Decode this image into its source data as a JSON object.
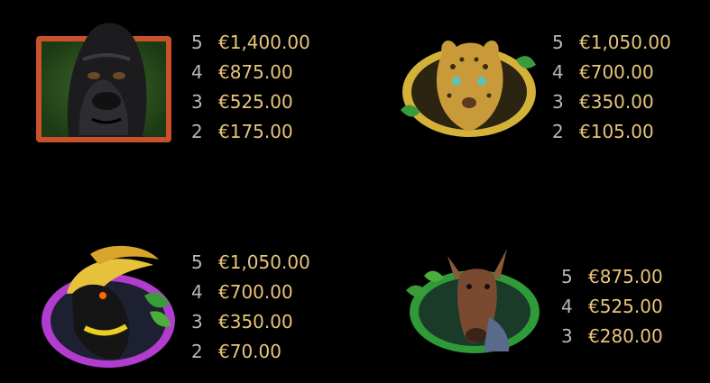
{
  "paytable": [
    {
      "symbol_icon": "gorilla-icon",
      "frame_color": "#c8512b",
      "rows": [
        {
          "count": "5",
          "amount": "€1,400.00"
        },
        {
          "count": "4",
          "amount": "€875.00"
        },
        {
          "count": "3",
          "amount": "€525.00"
        },
        {
          "count": "2",
          "amount": "€175.00"
        }
      ]
    },
    {
      "symbol_icon": "leopard-icon",
      "frame_color": "#d4b23a",
      "rows": [
        {
          "count": "5",
          "amount": "€1,050.00"
        },
        {
          "count": "4",
          "amount": "€700.00"
        },
        {
          "count": "3",
          "amount": "€350.00"
        },
        {
          "count": "2",
          "amount": "€105.00"
        }
      ]
    },
    {
      "symbol_icon": "hornbill-icon",
      "frame_color": "#b23bd0",
      "rows": [
        {
          "count": "5",
          "amount": "€1,050.00"
        },
        {
          "count": "4",
          "amount": "€700.00"
        },
        {
          "count": "3",
          "amount": "€350.00"
        },
        {
          "count": "2",
          "amount": "€70.00"
        }
      ]
    },
    {
      "symbol_icon": "okapi-icon",
      "frame_color": "#2f9a38",
      "rows": [
        {
          "count": "5",
          "amount": "€875.00"
        },
        {
          "count": "4",
          "amount": "€525.00"
        },
        {
          "count": "3",
          "amount": "€280.00"
        }
      ]
    }
  ],
  "colors": {
    "count_text": "#b7b7b7",
    "amount_text": "#e8c57a",
    "background": "#000000"
  }
}
